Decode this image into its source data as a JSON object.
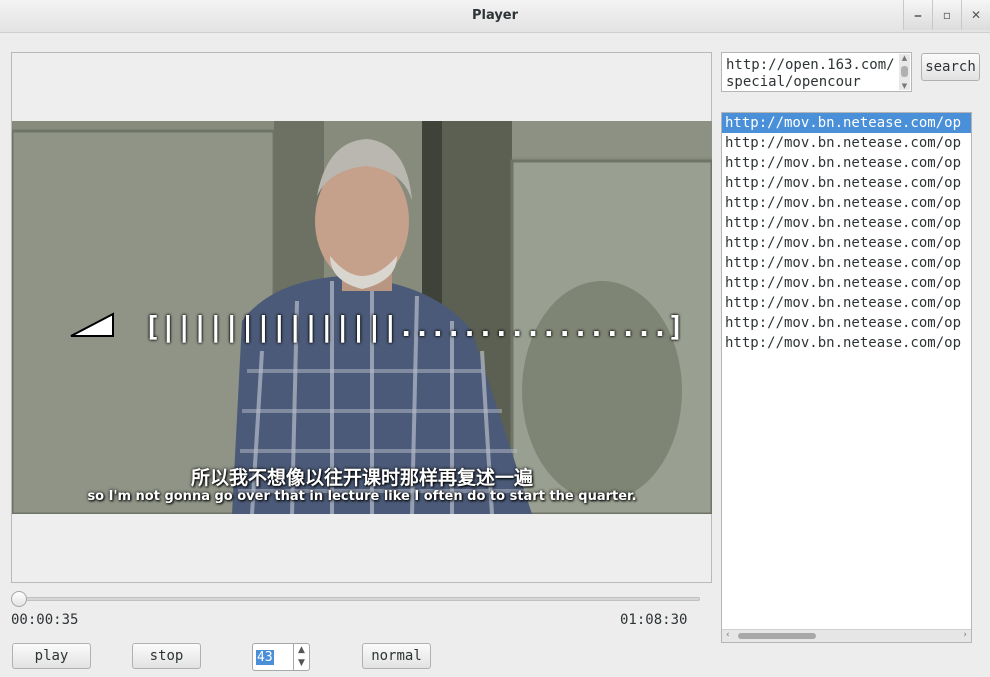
{
  "window": {
    "title": "Player",
    "buttons": {
      "minimize": "⎯",
      "maximize": "▫",
      "close": "✕"
    }
  },
  "video": {
    "osd_volume_bar": "[|||||||||||||||.................]",
    "subtitle_cn": "所以我不想像以往开课时那样再复述一遍",
    "subtitle_en": "so I'm not gonna go over that in lecture like I often do to start the quarter."
  },
  "seek": {
    "position_fraction": 0.008
  },
  "times": {
    "current": "00:00:35",
    "total": "01:08:30"
  },
  "controls": {
    "play_label": "play",
    "stop_label": "stop",
    "spin_value": "43",
    "speed_label": "normal"
  },
  "url_field": {
    "value": "http://open.163.com/special/opencour"
  },
  "search": {
    "label": "search"
  },
  "results": [
    "http://mov.bn.netease.com/op",
    "http://mov.bn.netease.com/op",
    "http://mov.bn.netease.com/op",
    "http://mov.bn.netease.com/op",
    "http://mov.bn.netease.com/op",
    "http://mov.bn.netease.com/op",
    "http://mov.bn.netease.com/op",
    "http://mov.bn.netease.com/op",
    "http://mov.bn.netease.com/op",
    "http://mov.bn.netease.com/op",
    "http://mov.bn.netease.com/op",
    "http://mov.bn.netease.com/op"
  ],
  "selected_result_index": 0
}
